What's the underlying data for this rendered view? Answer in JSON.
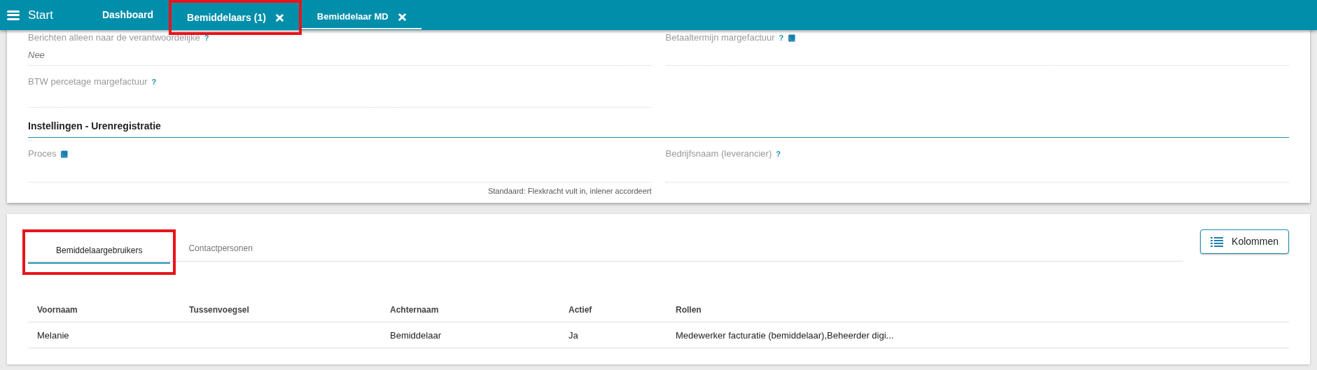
{
  "header": {
    "menu_label": "Start",
    "tabs": [
      {
        "label": "Dashboard",
        "selected": false,
        "closable": false,
        "highlighted": false
      },
      {
        "label": "Bemiddelaars (1)",
        "selected": false,
        "closable": true,
        "highlighted": true
      },
      {
        "label": "Bemiddelaar MD",
        "selected": true,
        "closable": true,
        "highlighted": false
      }
    ]
  },
  "settings": {
    "top_fields": [
      {
        "label": "Berichten alleen naar de verantwoordelijke",
        "help": "?",
        "book": false,
        "value": "Nee"
      },
      {
        "label": "Betaaltermijn margefactuur",
        "help": "?",
        "book": true
      },
      {
        "label": "BTW percetage margefactuur",
        "help": "?",
        "book": false
      }
    ],
    "section_title": "Instellingen - Urenregistratie",
    "section_fields": [
      {
        "label": "Proces",
        "book": true,
        "hint": "Standaard: Flexkracht vult in, inlener accordeert"
      },
      {
        "label": "Bedrijfsnaam (leverancier)",
        "help": "?",
        "book": false
      }
    ]
  },
  "detail": {
    "tabs": [
      {
        "label": "Bemiddelaargebruikers",
        "selected": true,
        "highlighted": true
      },
      {
        "label": "Contactpersonen",
        "selected": false,
        "highlighted": false
      }
    ],
    "columns_button": "Kolommen",
    "table": {
      "columns": [
        "Voornaam",
        "Tussenvoegsel",
        "Achternaam",
        "Actief",
        "Rollen"
      ],
      "rows": [
        [
          "Melanie",
          "",
          "Bemiddelaar",
          "Ja",
          "Medewerker facturatie (bemiddelaar),Beheerder digi..."
        ]
      ]
    }
  }
}
